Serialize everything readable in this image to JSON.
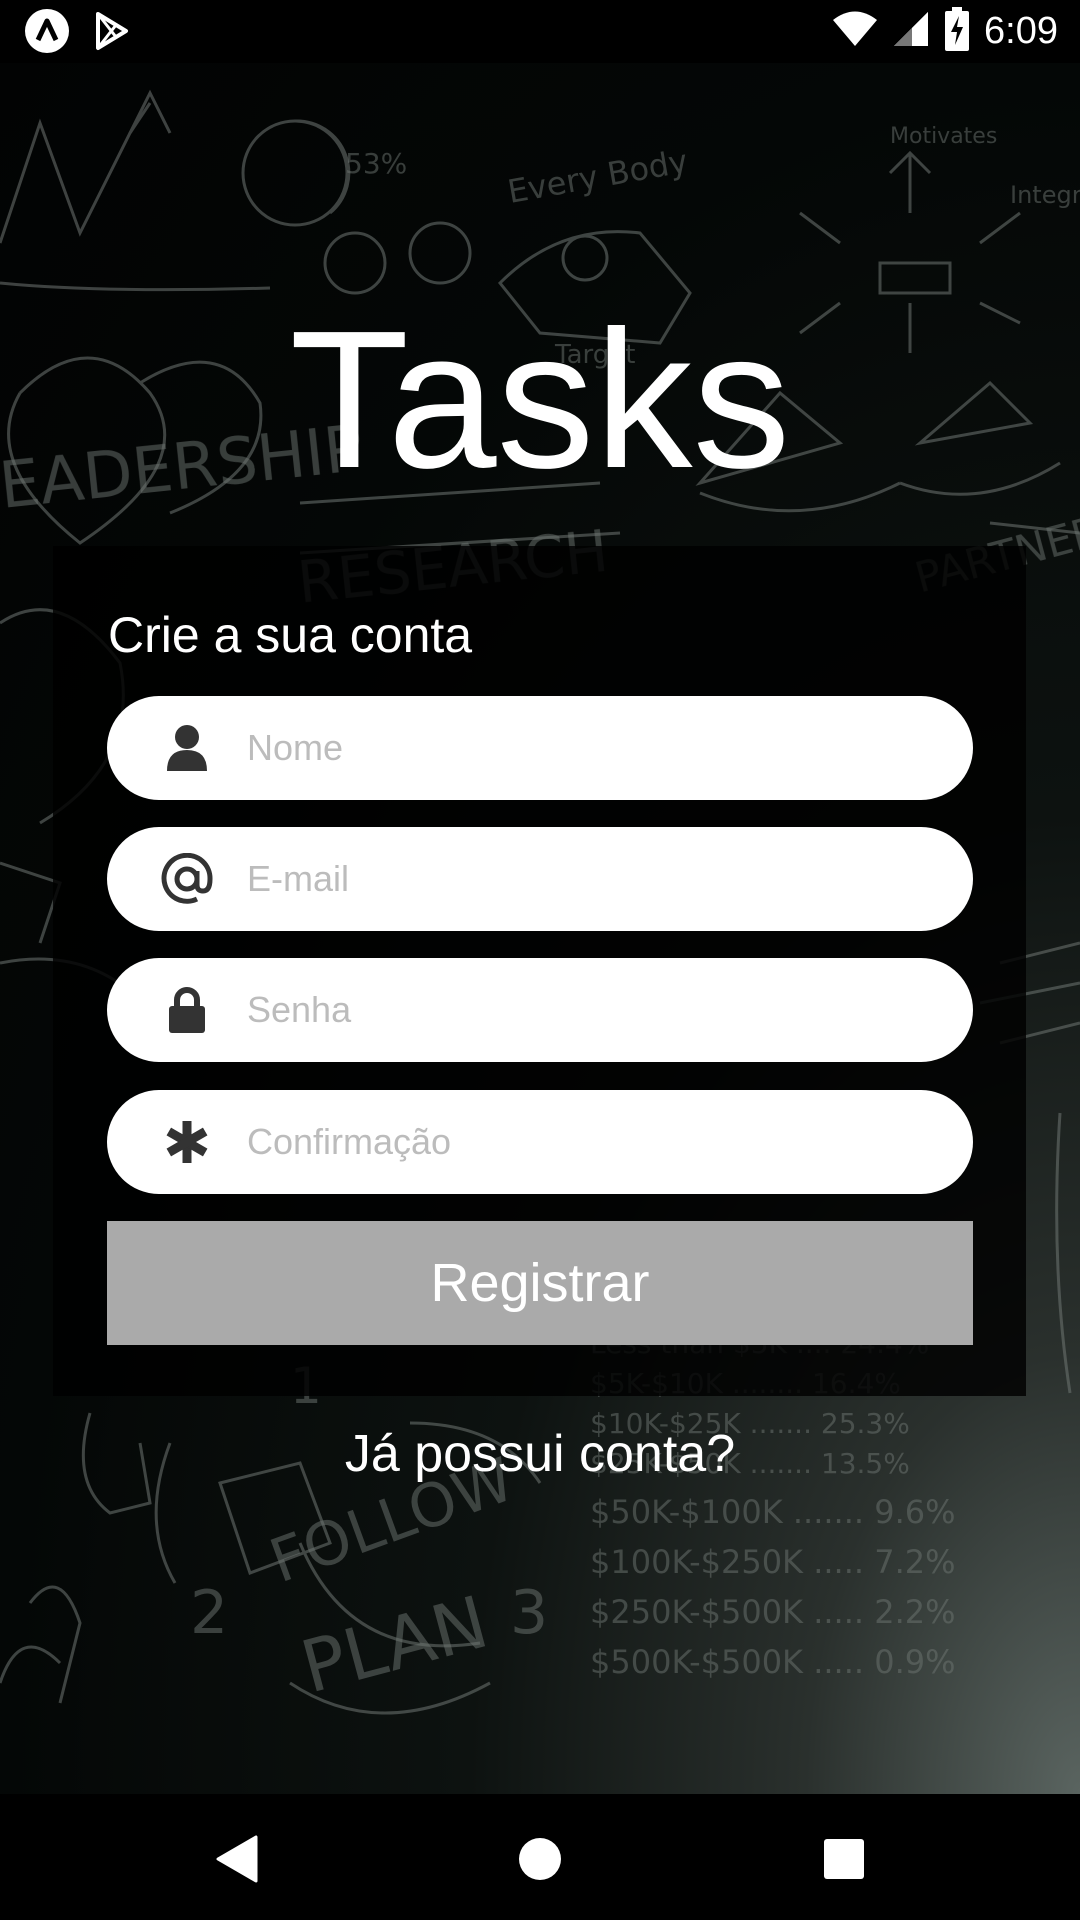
{
  "status_bar": {
    "time": "6:09",
    "icons": [
      "notification-a-icon",
      "play-store-icon",
      "wifi-icon",
      "signal-icon",
      "battery-charging-icon"
    ]
  },
  "app": {
    "title": "Tasks"
  },
  "form": {
    "subtitle": "Crie a sua conta",
    "fields": [
      {
        "icon": "user-icon",
        "placeholder": "Nome",
        "value": ""
      },
      {
        "icon": "at-icon",
        "placeholder": "E-mail",
        "value": ""
      },
      {
        "icon": "lock-icon",
        "placeholder": "Senha",
        "value": ""
      },
      {
        "icon": "asterisk-icon",
        "placeholder": "Confirmação",
        "value": ""
      }
    ],
    "register_label": "Registrar",
    "login_link": "Já possui conta?"
  },
  "nav_bar": {
    "buttons": [
      "back-icon",
      "home-icon",
      "recents-icon"
    ]
  },
  "colors": {
    "button_disabled": "#aaaaaa",
    "card_bg": "#000000",
    "placeholder": "#bcbcbc",
    "icon": "#333333"
  }
}
